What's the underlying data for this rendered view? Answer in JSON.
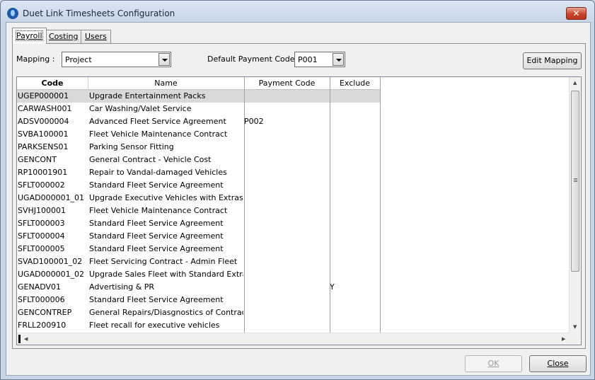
{
  "window": {
    "title": "Duet Link Timesheets Configuration",
    "close_glyph": "✕"
  },
  "tabs": [
    {
      "label": "Payroll",
      "active": true
    },
    {
      "label": "Costing",
      "active": false
    },
    {
      "label": "Users",
      "active": false
    }
  ],
  "mapping": {
    "label": "Mapping :",
    "value": "Project"
  },
  "default_payment_code": {
    "label": "Default Payment Code :",
    "value": "P001"
  },
  "edit_mapping_label": "Edit Mapping",
  "grid": {
    "columns": [
      "Code",
      "Name",
      "Payment Code",
      "Exclude"
    ],
    "rows": [
      {
        "code": "UGEP000001",
        "name": "Upgrade Entertainment Packs",
        "payment_code": "",
        "exclude": ""
      },
      {
        "code": "CARWASH001",
        "name": "Car Washing/Valet Service",
        "payment_code": "",
        "exclude": ""
      },
      {
        "code": "ADSV000004",
        "name": "Advanced Fleet Service Agreement",
        "payment_code": "P002",
        "exclude": ""
      },
      {
        "code": "SVBA100001",
        "name": "Fleet Vehicle Maintenance Contract",
        "payment_code": "",
        "exclude": ""
      },
      {
        "code": "PARKSENS01",
        "name": "Parking Sensor Fitting",
        "payment_code": "",
        "exclude": ""
      },
      {
        "code": "GENCONT",
        "name": "General Contract - Vehicle Cost",
        "payment_code": "",
        "exclude": ""
      },
      {
        "code": "RP10001901",
        "name": "Repair to Vandal-damaged Vehicles",
        "payment_code": "",
        "exclude": ""
      },
      {
        "code": "SFLT000002",
        "name": "Standard Fleet Service Agreement",
        "payment_code": "",
        "exclude": ""
      },
      {
        "code": "UGAD000001_01",
        "name": "Upgrade Executive Vehicles with Extras",
        "payment_code": "",
        "exclude": ""
      },
      {
        "code": "SVHJ100001",
        "name": "Fleet Vehicle Maintenance Contract",
        "payment_code": "",
        "exclude": ""
      },
      {
        "code": "SFLT000003",
        "name": "Standard Fleet Service Agreement",
        "payment_code": "",
        "exclude": ""
      },
      {
        "code": "SFLT000004",
        "name": "Standard Fleet Service Agreement",
        "payment_code": "",
        "exclude": ""
      },
      {
        "code": "SFLT000005",
        "name": "Standard Fleet Service Agreement",
        "payment_code": "",
        "exclude": ""
      },
      {
        "code": "SVAD100001_02",
        "name": "Fleet Servicing Contract - Admin Fleet",
        "payment_code": "",
        "exclude": ""
      },
      {
        "code": "UGAD000001_02",
        "name": "Upgrade Sales Fleet with Standard Extras",
        "payment_code": "",
        "exclude": ""
      },
      {
        "code": "GENADV01",
        "name": "Advertising & PR",
        "payment_code": "",
        "exclude": "Y"
      },
      {
        "code": "SFLT000006",
        "name": "Standard Fleet Service Agreement",
        "payment_code": "",
        "exclude": ""
      },
      {
        "code": "GENCONTREP",
        "name": "General Repairs/Diasgnostics of Contract",
        "payment_code": "",
        "exclude": ""
      },
      {
        "code": "FRLL200910",
        "name": "Fleet recall for executive vehicles",
        "payment_code": "",
        "exclude": ""
      }
    ],
    "selected_row": 0
  },
  "buttons": {
    "ok": "OK",
    "close": "Close"
  },
  "icons": {
    "app": "duet-logo-icon",
    "dropdown": "chevron-down-icon"
  }
}
